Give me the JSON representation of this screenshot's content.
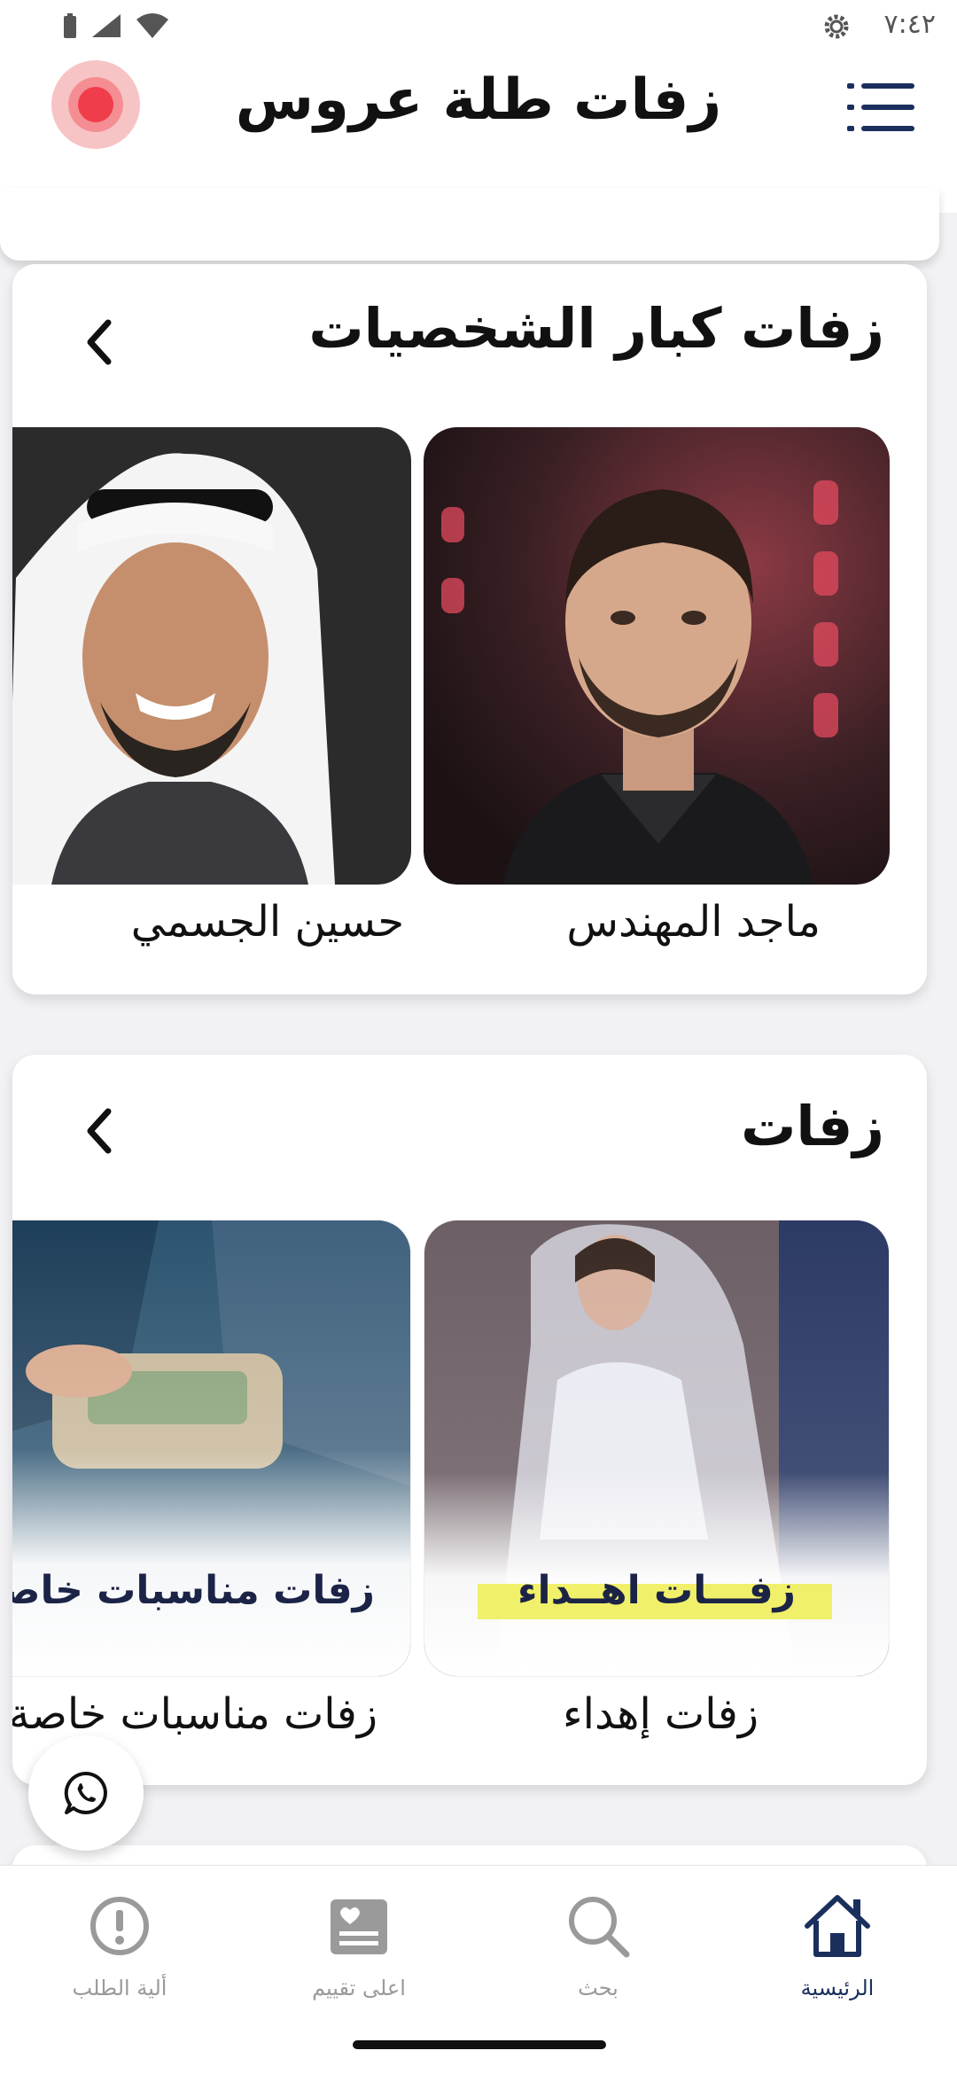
{
  "status_bar": {
    "time": "٧:٤٢"
  },
  "header": {
    "title": "زفات طلة عروس"
  },
  "sections": [
    {
      "title": "زفات كبار الشخصيات",
      "items": [
        {
          "label": "ماجد المهندس"
        },
        {
          "label": "حسين الجسمي"
        }
      ]
    },
    {
      "title": "زفات",
      "items": [
        {
          "label": "زفات إهداء",
          "banner_text": "زفـــات اهــداء"
        },
        {
          "label": "زفات مناسبات خاصة",
          "banner_text": "زفات مناسبات خاصة"
        }
      ]
    }
  ],
  "bottom_nav": [
    {
      "label": "الرئيسية",
      "icon": "home-icon",
      "active": true
    },
    {
      "label": "بحث",
      "icon": "search-icon",
      "active": false
    },
    {
      "label": "اعلى تقييم",
      "icon": "top-rated-icon",
      "active": false
    },
    {
      "label": "ألية الطلب",
      "icon": "info-icon",
      "active": false
    }
  ],
  "colors": {
    "accent": "#1a2f5c",
    "record": "#ef3d4b",
    "inactive": "#9a9a9a"
  }
}
